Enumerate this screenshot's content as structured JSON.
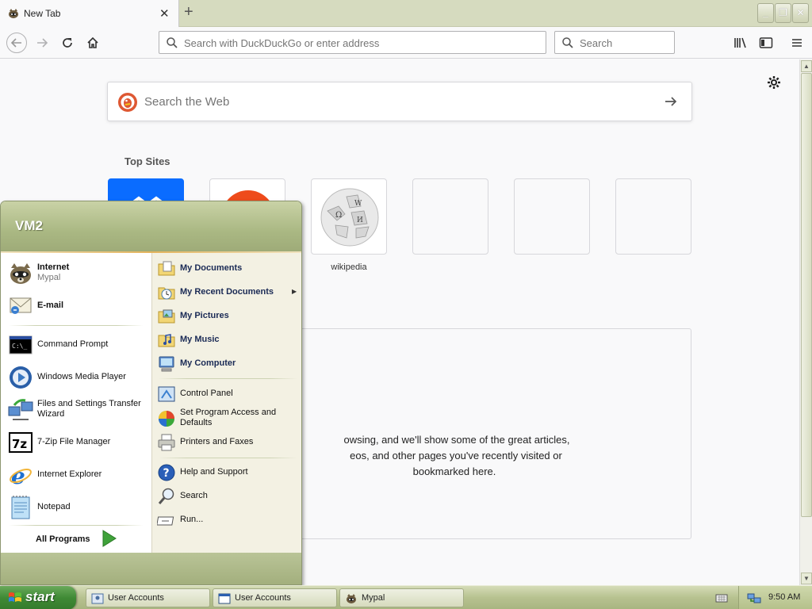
{
  "browser": {
    "tab_title": "New Tab",
    "url_placeholder": "Search with DuckDuckGo or enter address",
    "search_placeholder": "Search"
  },
  "newtab": {
    "search_placeholder": "Search the Web",
    "top_sites_title": "Top Sites",
    "top_sites": [
      {
        "label": "",
        "icon": "blue-site-icon"
      },
      {
        "label": "",
        "icon": "orange-site-icon"
      },
      {
        "label": "wikipedia",
        "icon": "wikipedia-globe-icon"
      },
      {
        "label": "",
        "icon": ""
      },
      {
        "label": "",
        "icon": ""
      },
      {
        "label": "",
        "icon": ""
      }
    ],
    "highlights_lines": [
      "owsing, and we'll show some of the great articles,",
      "eos, and other pages you've recently visited or",
      "bookmarked here."
    ]
  },
  "startmenu": {
    "user": "VM2",
    "pinned": [
      {
        "label": "Internet",
        "sub": "Mypal"
      },
      {
        "label": "E-mail"
      }
    ],
    "recent": [
      {
        "label": "Command Prompt"
      },
      {
        "label": "Windows Media Player"
      },
      {
        "label": "Files and Settings Transfer Wizard"
      },
      {
        "label": "7-Zip File Manager"
      },
      {
        "label": "Internet Explorer"
      },
      {
        "label": "Notepad"
      }
    ],
    "all_programs": "All Programs",
    "places": [
      {
        "label": "My Documents"
      },
      {
        "label": "My Recent Documents"
      },
      {
        "label": "My Pictures"
      },
      {
        "label": "My Music"
      },
      {
        "label": "My Computer"
      }
    ],
    "settings": [
      {
        "label": "Control Panel"
      },
      {
        "label": "Set Program Access and Defaults"
      },
      {
        "label": "Printers and Faxes"
      }
    ],
    "help": [
      {
        "label": "Help and Support"
      },
      {
        "label": "Search"
      },
      {
        "label": "Run..."
      }
    ]
  },
  "taskbar": {
    "start_label": "start",
    "tasks": [
      {
        "label": "User Accounts"
      },
      {
        "label": "User Accounts"
      },
      {
        "label": "Mypal"
      }
    ],
    "clock": "9:50 AM"
  }
}
